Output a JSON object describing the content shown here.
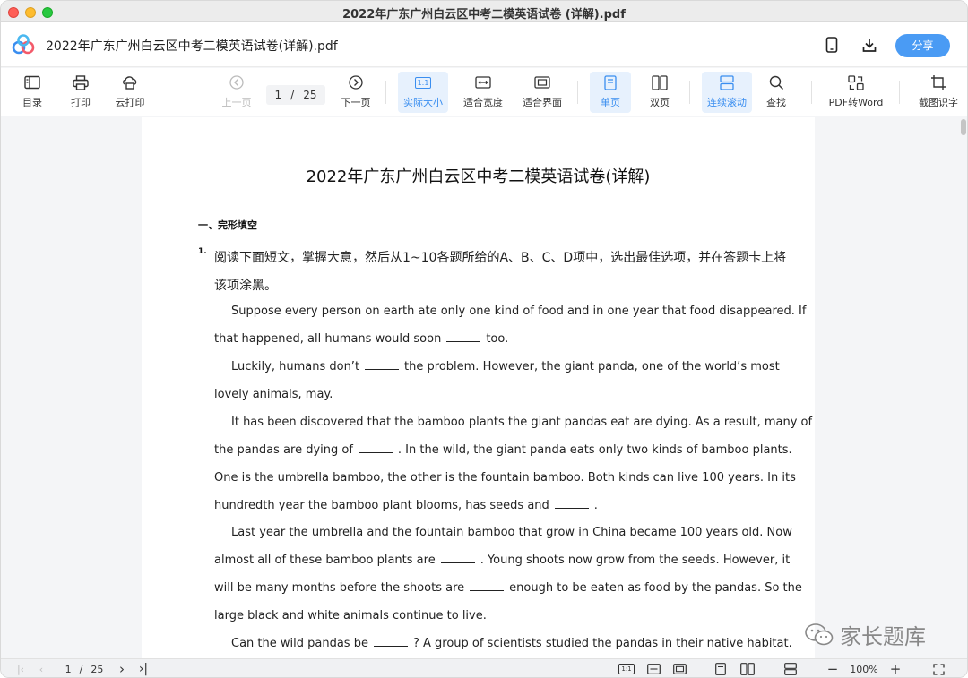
{
  "window": {
    "title": "2022年广东广州白云区中考二模英语试卷 (详解).pdf"
  },
  "appbar": {
    "doc_title": "2022年广东广州白云区中考二模英语试卷(详解).pdf",
    "share_label": "分享"
  },
  "toolbar": {
    "toc": "目录",
    "print": "打印",
    "cloud_print": "云打印",
    "prev_page": "上一页",
    "current_page": "1",
    "page_sep": "/",
    "total_pages": "25",
    "next_page": "下一页",
    "actual_size": "实际大小",
    "actual_size_glyph": "1:1",
    "fit_width": "适合宽度",
    "fit_page": "适合界面",
    "single_page": "单页",
    "double_page": "双页",
    "continuous": "连续滚动",
    "search": "查找",
    "pdf_to_word": "PDF转Word",
    "ocr": "截图识字"
  },
  "document": {
    "title": "2022年广东广州白云区中考二模英语试卷(详解)",
    "section": "一、完形填空",
    "question_number": "1.",
    "lines": [
      "阅读下面短文，掌握大意，然后从1~10各题所给的A、B、C、D项中，选出最佳选项，并在答题卡上将",
      "该项涂黑。",
      "Suppose every person on earth ate only one kind of food and in one year that food disappeared. If",
      "that happened, all humans would soon",
      "too.",
      "Luckily, humans don’t",
      "the problem. However, the giant panda, one of the world’s most",
      "lovely animals, may.",
      "It has been discovered that the bamboo plants the giant pandas eat are dying. As a result, many of",
      "the pandas are dying of",
      ". In the wild, the giant panda eats only two kinds of bamboo plants.",
      "One is the umbrella bamboo, the other is the fountain bamboo. Both kinds can live 100 years. In its",
      "hundredth year the bamboo plant blooms, has seeds and",
      ".",
      "Last year the umbrella and the fountain bamboo that grow in China became 100 years old. Now",
      "almost all of these bamboo plants are",
      ". Young shoots now grow from the seeds. However, it",
      "will be many months before the shoots are",
      "enough to be eaten as food by the pandas. So the",
      "large black and white animals continue to live.",
      "Can the wild pandas be",
      "? A group of scientists studied the pandas in their native habitat."
    ]
  },
  "watermark": {
    "text": "家长题库"
  },
  "statusbar": {
    "current_page": "1",
    "page_sep": "/",
    "total_pages": "25",
    "zoom": "100%",
    "actual_size_glyph": "1:1"
  },
  "colors": {
    "accent": "#4a9bf4",
    "active_bg": "#e7f1fd"
  }
}
